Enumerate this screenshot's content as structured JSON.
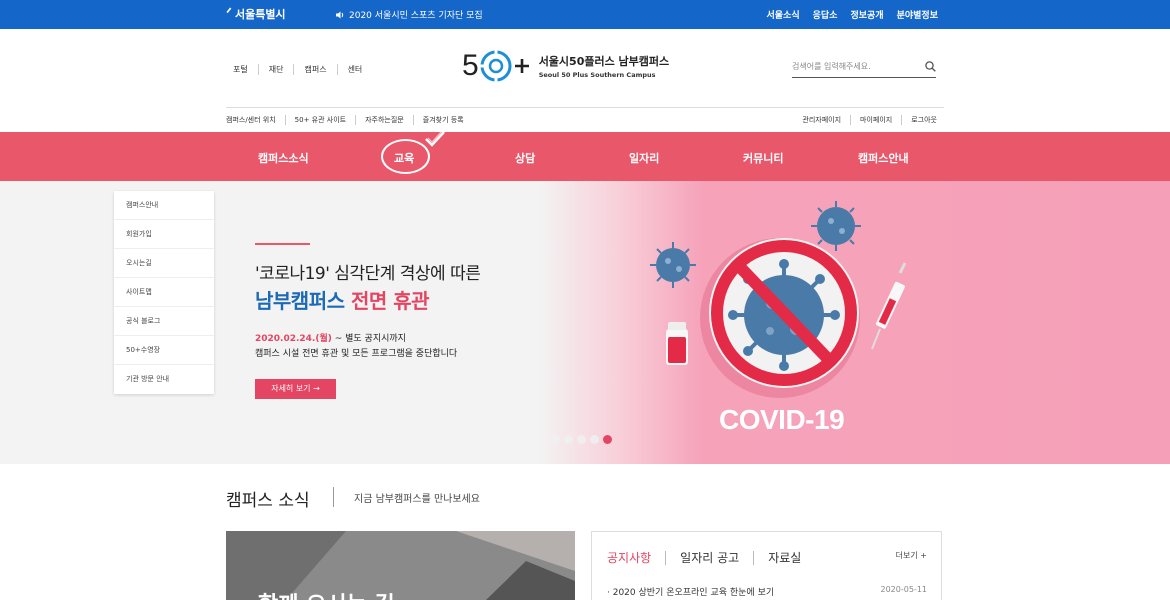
{
  "topbar": {
    "logo": "서울특별시",
    "notice": "2020 서울시민 스포츠 기자단 모집",
    "links": [
      "서울소식",
      "응답소",
      "정보공개",
      "분야별정보"
    ]
  },
  "header": {
    "util_links": [
      "포털",
      "재단",
      "캠퍼스",
      "센터"
    ],
    "brand_name": "서울시50플러스 남부캠퍼스",
    "brand_en": "Seoul 50 Plus Southern Campus",
    "search_placeholder": "검색어를 입력해주세요.",
    "sub_links_left": [
      "캠퍼스/센터 위치",
      "50+ 유관 사이트",
      "자주하는질문",
      "즐겨찾기 등록"
    ],
    "sub_links_right": [
      "관리자페이지",
      "마이페이지",
      "로그아웃"
    ]
  },
  "gnb": [
    "캠퍼스소식",
    "교육",
    "상담",
    "일자리",
    "커뮤니티",
    "캠퍼스안내"
  ],
  "side_menu": [
    "캠퍼스안내",
    "회원가입",
    "오시는길",
    "사이트맵",
    "공식 블로그",
    "50+수영장",
    "기관 방문 안내"
  ],
  "hero": {
    "title_line1": "'코로나19' 심각단계 격상에 따른",
    "title_line2_blue": "남부캠퍼스",
    "title_line2_red": "전면 휴관",
    "date": "2020.02.24.(월)",
    "date_suffix": " ~ 별도 공지시까지",
    "desc": "캠퍼스 시설 전면 휴관 및 모든 프로그램을 중단합니다",
    "button": "자세히 보기 →",
    "covid_label": "COVID-19",
    "slides": 5,
    "active_slide": 5
  },
  "news": {
    "title": "캠퍼스 소식",
    "subtitle": "지금 남부캠퍼스를 만나보세요",
    "board_tabs": [
      "공지사항",
      "일자리 공고",
      "자료실"
    ],
    "more": "더보기 +",
    "items": [
      {
        "title": "· 2020 상반기 온오프라인 교육 한눈에 보기",
        "date": "2020-05-11"
      }
    ]
  },
  "colors": {
    "topbar": "#1566c9",
    "gnb": "#e9586a",
    "accent_red": "#e44562",
    "accent_blue": "#1c6ab5"
  }
}
